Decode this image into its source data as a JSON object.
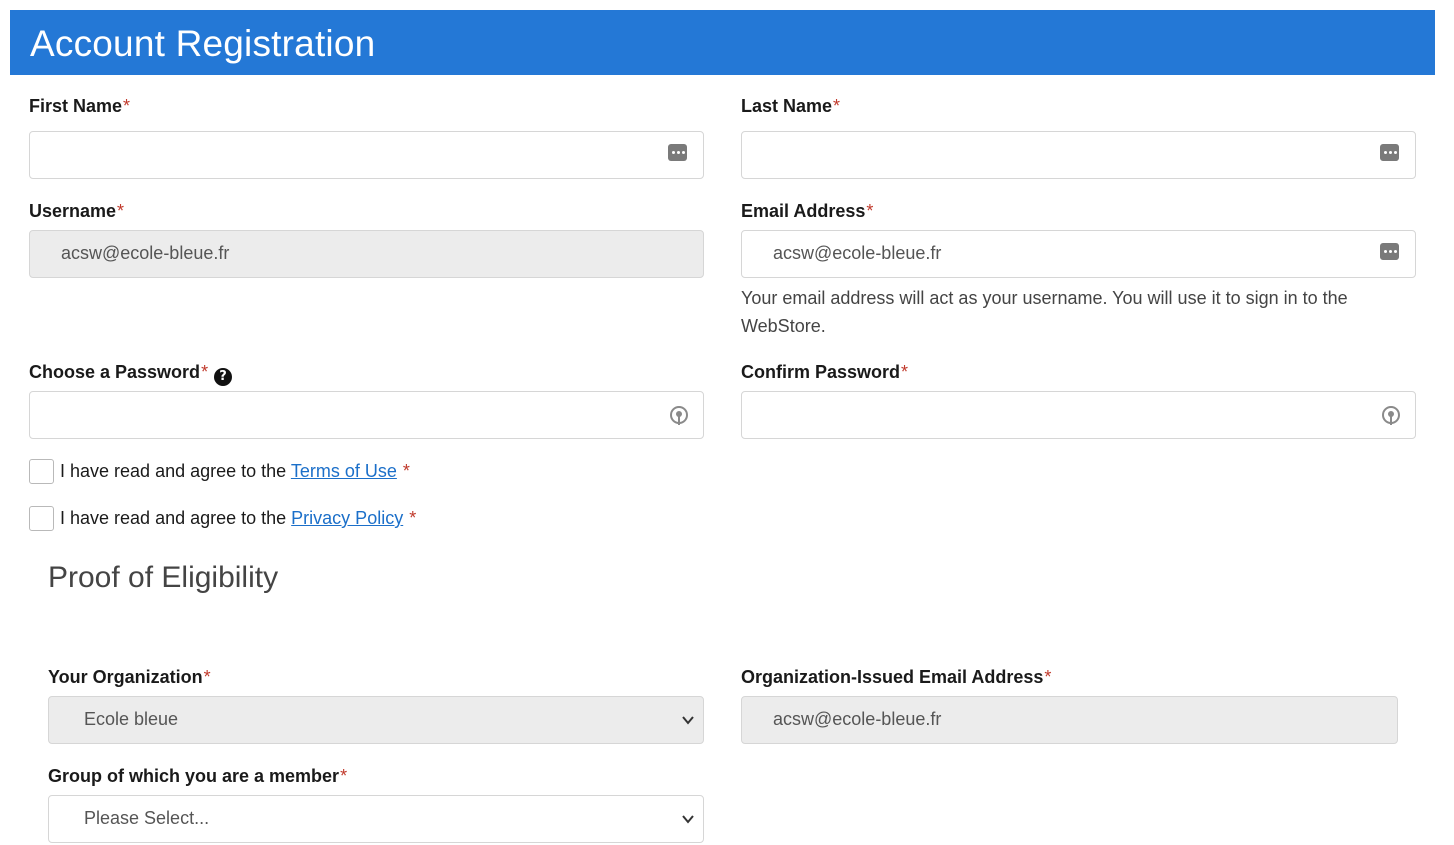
{
  "header": {
    "title": "Account Registration"
  },
  "required_mark": "*",
  "first_name": {
    "label": "First Name",
    "value": ""
  },
  "last_name": {
    "label": "Last Name",
    "value": ""
  },
  "username": {
    "label": "Username",
    "value": "acsw@ecole-bleue.fr"
  },
  "email": {
    "label": "Email Address",
    "value": "acsw@ecole-bleue.fr",
    "help": "Your email address will act as your username. You will use it to sign in to the WebStore."
  },
  "password": {
    "label": "Choose a Password",
    "help_icon": "question-circle-icon",
    "value": ""
  },
  "confirm_password": {
    "label": "Confirm Password",
    "value": ""
  },
  "terms": {
    "prefix": "I have read and agree to the ",
    "link": "Terms of Use",
    "checked": false
  },
  "privacy": {
    "prefix": "I have read and agree to the ",
    "link": "Privacy Policy",
    "checked": false
  },
  "eligibility": {
    "title": "Proof of Eligibility",
    "organization": {
      "label": "Your Organization",
      "value": "Ecole bleue"
    },
    "org_email": {
      "label": "Organization-Issued Email Address",
      "value": "acsw@ecole-bleue.fr"
    },
    "group": {
      "label": "Group of which you are a member",
      "value": "Please Select..."
    }
  }
}
